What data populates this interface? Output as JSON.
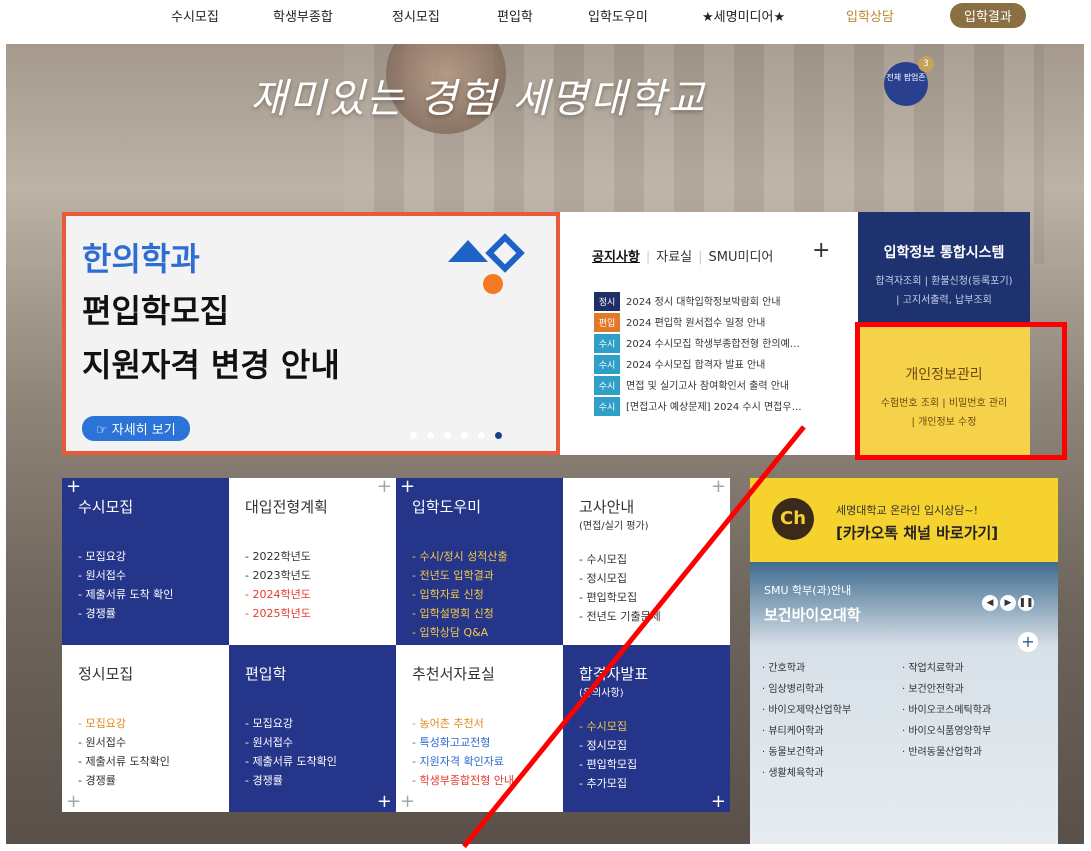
{
  "nav": {
    "items": [
      "수시모집",
      "학생부종합",
      "정시모집",
      "편입학",
      "입학도우미",
      "★세명미디어★",
      "입학상담",
      "입학결과"
    ]
  },
  "hero": {
    "slogan": "재미있는 경험 세명대학교",
    "popzone_label": "전체 팝업존",
    "popzone_count": "3"
  },
  "notice_panel": {
    "line1": "한의학과",
    "line2": "편입학모집",
    "line3": "지원자격 변경 안내",
    "more": "☞ 자세히 보기"
  },
  "news": {
    "tabs": [
      "공지사항",
      "자료실",
      "SMU미디어"
    ],
    "plus": "+",
    "items": [
      {
        "tag": "정시",
        "color": "#1f2f66",
        "text": "2024 정시 대학입학정보박람회 안내"
      },
      {
        "tag": "편입",
        "color": "#e07a2a",
        "text": "2024 편입학 원서접수 일정 안내"
      },
      {
        "tag": "수시",
        "color": "#2f9fc7",
        "text": "2024 수시모집 학생부종합전형 한의예…"
      },
      {
        "tag": "수시",
        "color": "#2f9fc7",
        "text": "2024 수시모집 합격자 발표 안내"
      },
      {
        "tag": "수시",
        "color": "#2f9fc7",
        "text": "면접 및 실기고사 참여확인서 출력 안내"
      },
      {
        "tag": "수시",
        "color": "#2f9fc7",
        "text": "[면접고사 예상문제] 2024 수시 면접우…"
      }
    ]
  },
  "system": {
    "title": "입학정보 통합시스템",
    "line1": "합격자조회 | 환불신청(등록포기)",
    "line2": "| 고지서출력, 납부조회"
  },
  "privacy": {
    "title": "개인정보관리",
    "line1": "수험번호 조회 | 비밀번호 관리",
    "line2": "| 개인정보 수정"
  },
  "grid": {
    "c1": {
      "title": "수시모집",
      "items": [
        "모집요강",
        "원서접수",
        "제출서류 도착 확인",
        "경쟁률"
      ]
    },
    "c2": {
      "title": "대입전형계획",
      "items": [
        "2022학년도",
        "2023학년도",
        "2024학년도",
        "2025학년도"
      ]
    },
    "c3": {
      "title": "입학도우미",
      "items": [
        "수시/정시 성적산출",
        "전년도 입학결과",
        "입학자료 신청",
        "입학설명회 신청",
        "입학상담 Q&A"
      ]
    },
    "c4": {
      "title": "고사안내",
      "sub": "(면접/실기 평가)",
      "items": [
        "수시모집",
        "정시모집",
        "편입학모집",
        "전년도 기출문제"
      ]
    },
    "c5": {
      "title": "정시모집",
      "items": [
        "모집요강",
        "원서접수",
        "제출서류 도착확인",
        "경쟁률"
      ]
    },
    "c6": {
      "title": "편입학",
      "items": [
        "모집요강",
        "원서접수",
        "제출서류 도착확인",
        "경쟁률"
      ]
    },
    "c7": {
      "title": "추천서자료실",
      "items": [
        "농어촌 추천서",
        "특성화고교전형",
        "지원자격 확인자료",
        "학생부종합전형 안내"
      ]
    },
    "c8": {
      "title": "합격자발표",
      "sub": "(유의사항)",
      "items": [
        "수시모집",
        "정시모집",
        "편입학모집",
        "추가모집"
      ]
    }
  },
  "kakao": {
    "line1": "세명대학교 온라인 입시상담~!",
    "line2": "[카카오톡 채널 바로가기]",
    "icon": "Ch"
  },
  "majors": {
    "kicker": "SMU 학부(과)안내",
    "title": "보건바이오대학",
    "left": [
      "간호학과",
      "임상병리학과",
      "바이오제약산업학부",
      "뷰티케어학과",
      "동물보건학과",
      "생활체육학과"
    ],
    "right": [
      "작업치료학과",
      "보건안전학과",
      "바이오코스메틱학과",
      "바이오식품영양학부",
      "반려동물산업학과"
    ]
  },
  "colors": {
    "accent_red": "#ff0000",
    "navy": "#25358a",
    "yellow": "#f6d24a"
  }
}
